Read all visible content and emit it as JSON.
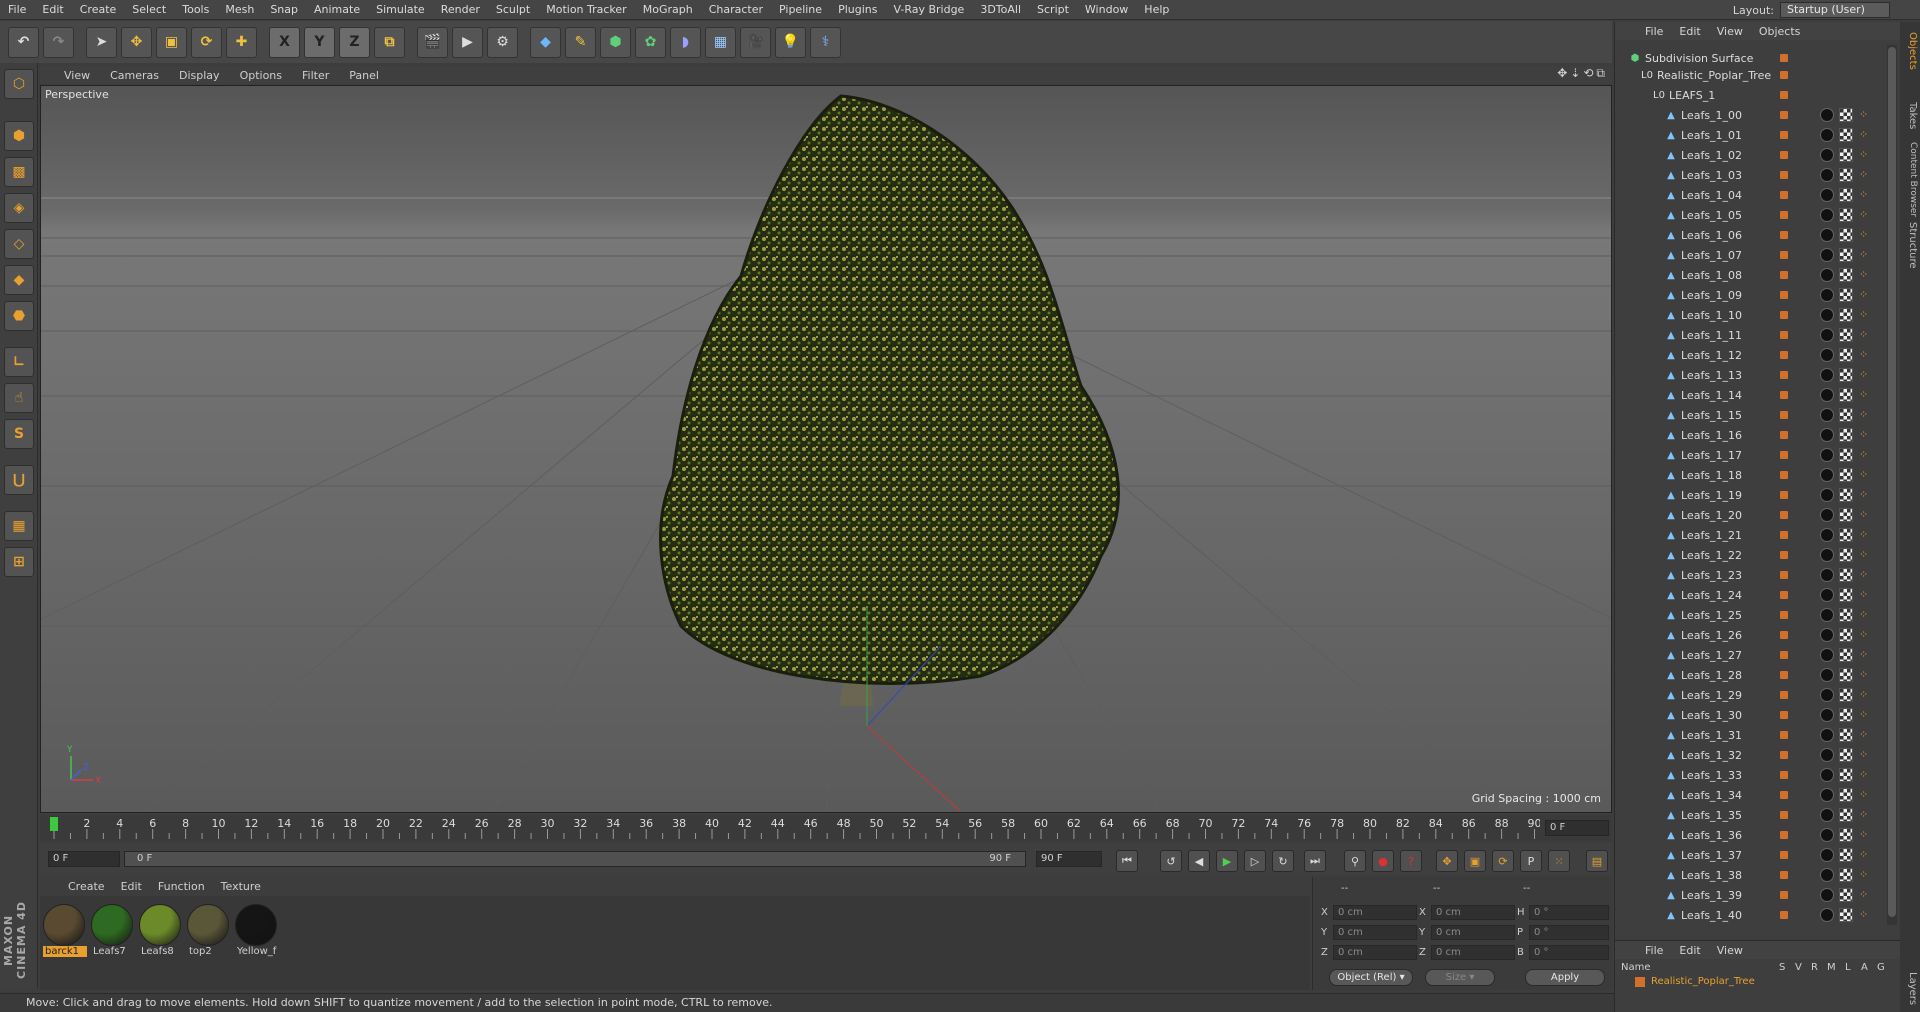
{
  "menu": [
    "File",
    "Edit",
    "Create",
    "Select",
    "Tools",
    "Mesh",
    "Snap",
    "Animate",
    "Simulate",
    "Render",
    "Sculpt",
    "Motion Tracker",
    "MoGraph",
    "Character",
    "Pipeline",
    "Plugins",
    "V-Ray Bridge",
    "3DToAll",
    "Script",
    "Window",
    "Help"
  ],
  "layout": {
    "label": "Layout:",
    "value": "Startup (User)"
  },
  "axis": {
    "x": "X",
    "y": "Y",
    "z": "Z"
  },
  "viewport": {
    "menu": [
      "View",
      "Cameras",
      "Display",
      "Options",
      "Filter",
      "Panel"
    ],
    "label": "Perspective",
    "grid_spacing": "Grid Spacing : 1000 cm",
    "nav_icons": "✥⇣⟲⧉"
  },
  "timeline": {
    "ticks": [
      "0",
      "2",
      "4",
      "6",
      "8",
      "10",
      "12",
      "14",
      "16",
      "18",
      "20",
      "22",
      "24",
      "26",
      "28",
      "30",
      "32",
      "34",
      "36",
      "38",
      "40",
      "42",
      "44",
      "46",
      "48",
      "50",
      "52",
      "54",
      "56",
      "58",
      "60",
      "62",
      "64",
      "66",
      "68",
      "70",
      "72",
      "74",
      "76",
      "78",
      "80",
      "82",
      "84",
      "86",
      "88",
      "90"
    ],
    "frame_display": "0 F"
  },
  "playbar": {
    "start": "0 F",
    "range_start": "0 F",
    "range_end": "90 F",
    "end": "90 F"
  },
  "materials": {
    "menu": [
      "Create",
      "Edit",
      "Function",
      "Texture"
    ],
    "items": [
      {
        "name": "barck1",
        "color": "#5a4a32"
      },
      {
        "name": "Leafs7",
        "color": "#2f6a22"
      },
      {
        "name": "Leafs8",
        "color": "#6c8a2a"
      },
      {
        "name": "top2",
        "color": "#5a5638"
      },
      {
        "name": "Yellow_f",
        "color": "#151515"
      }
    ]
  },
  "coords": {
    "header_a": "--",
    "header_b": "--",
    "header_c": "--",
    "rows": [
      {
        "l1": "X",
        "v1": "0 cm",
        "l2": "X",
        "v2": "0 cm",
        "l3": "H",
        "v3": "0 °"
      },
      {
        "l1": "Y",
        "v1": "0 cm",
        "l2": "Y",
        "v2": "0 cm",
        "l3": "P",
        "v3": "0 °"
      },
      {
        "l1": "Z",
        "v1": "0 cm",
        "l2": "Z",
        "v2": "0 cm",
        "l3": "B",
        "v3": "0 °"
      }
    ],
    "mode": "Object (Rel) ▾",
    "size": "Size ▾",
    "apply": "Apply"
  },
  "status": "Move: Click and drag to move elements. Hold down SHIFT to quantize movement / add to the selection in point mode, CTRL to remove.",
  "objects": {
    "menu": [
      "File",
      "Edit",
      "View",
      "Objects"
    ],
    "root": "Subdivision Surface",
    "tree": "Realistic_Poplar_Tree",
    "group": "LEAFS_1",
    "leafs": [
      "Leafs_1_00",
      "Leafs_1_01",
      "Leafs_1_02",
      "Leafs_1_03",
      "Leafs_1_04",
      "Leafs_1_05",
      "Leafs_1_06",
      "Leafs_1_07",
      "Leafs_1_08",
      "Leafs_1_09",
      "Leafs_1_10",
      "Leafs_1_11",
      "Leafs_1_12",
      "Leafs_1_13",
      "Leafs_1_14",
      "Leafs_1_15",
      "Leafs_1_16",
      "Leafs_1_17",
      "Leafs_1_18",
      "Leafs_1_19",
      "Leafs_1_20",
      "Leafs_1_21",
      "Leafs_1_22",
      "Leafs_1_23",
      "Leafs_1_24",
      "Leafs_1_25",
      "Leafs_1_26",
      "Leafs_1_27",
      "Leafs_1_28",
      "Leafs_1_29",
      "Leafs_1_30",
      "Leafs_1_31",
      "Leafs_1_32",
      "Leafs_1_33",
      "Leafs_1_34",
      "Leafs_1_35",
      "Leafs_1_36",
      "Leafs_1_37",
      "Leafs_1_38",
      "Leafs_1_39",
      "Leafs_1_40"
    ]
  },
  "layers": {
    "menu": [
      "File",
      "Edit",
      "View"
    ],
    "columns": [
      "Name",
      "S",
      "V",
      "R",
      "M",
      "L",
      "A",
      "G"
    ],
    "row": "Realistic_Poplar_Tree"
  },
  "side_tabs": [
    "Objects",
    "Takes",
    "Content Browser",
    "Structure",
    "Layers"
  ],
  "maxon": "MAXON CINEMA 4D"
}
